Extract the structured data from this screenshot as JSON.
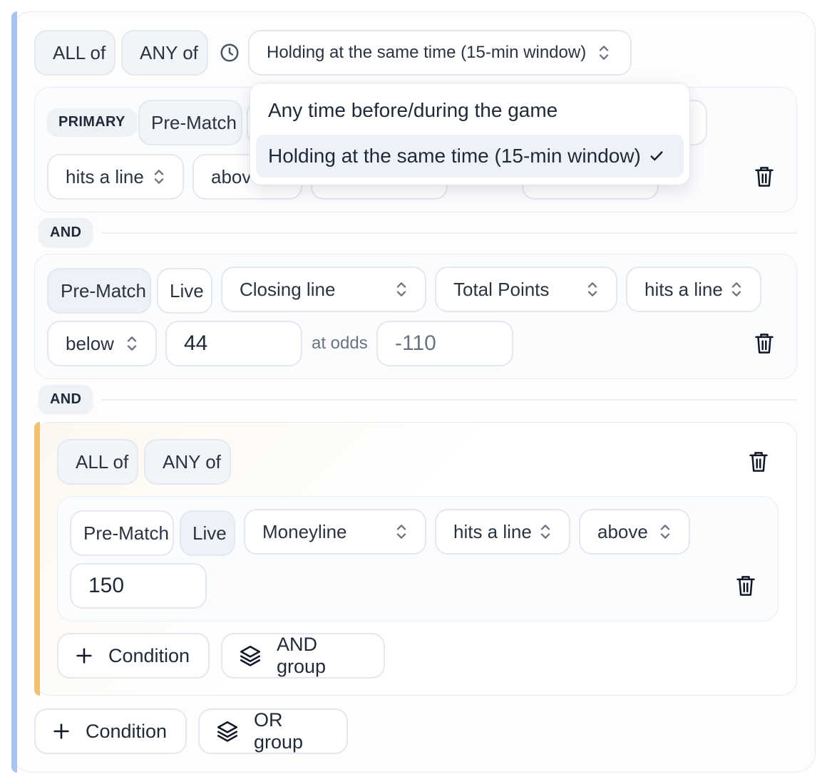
{
  "header": {
    "all_of": "ALL of",
    "any_of": "ANY of",
    "timing_select": "Holding at the same time (15-min window)"
  },
  "timing_dropdown": {
    "options": [
      "Any time before/during the game",
      "Holding at the same time (15-min window)"
    ],
    "selected": 1
  },
  "condition1": {
    "badge": "PRIMARY",
    "tab_prematch": "Pre-Match",
    "trigger": "hits a line",
    "direction": "above"
  },
  "joiners": [
    "AND",
    "AND"
  ],
  "condition2": {
    "tab_prematch": "Pre-Match",
    "tab_live": "Live",
    "line_type": "Closing line",
    "market": "Total Points",
    "trigger": "hits a line",
    "direction": "below",
    "value": "44",
    "at_odds_label": "at odds",
    "odds_placeholder": "-110"
  },
  "nested_group": {
    "all_of": "ALL of",
    "any_of": "ANY of",
    "condition": {
      "tab_prematch": "Pre-Match",
      "tab_live": "Live",
      "market": "Moneyline",
      "trigger": "hits a line",
      "direction": "above",
      "value": "150"
    },
    "add_condition": "Condition",
    "add_group": "AND group"
  },
  "footer": {
    "add_condition": "Condition",
    "add_group": "OR group"
  },
  "colors": {
    "outer_accent": "#a9c3f0",
    "group_accent": "#f0c16f"
  },
  "icons": {
    "clock": "clock-icon",
    "chevron": "chevron-up-down-icon",
    "trash": "trash-icon",
    "plus": "plus-icon",
    "layers": "layers-icon",
    "check": "check-icon"
  }
}
